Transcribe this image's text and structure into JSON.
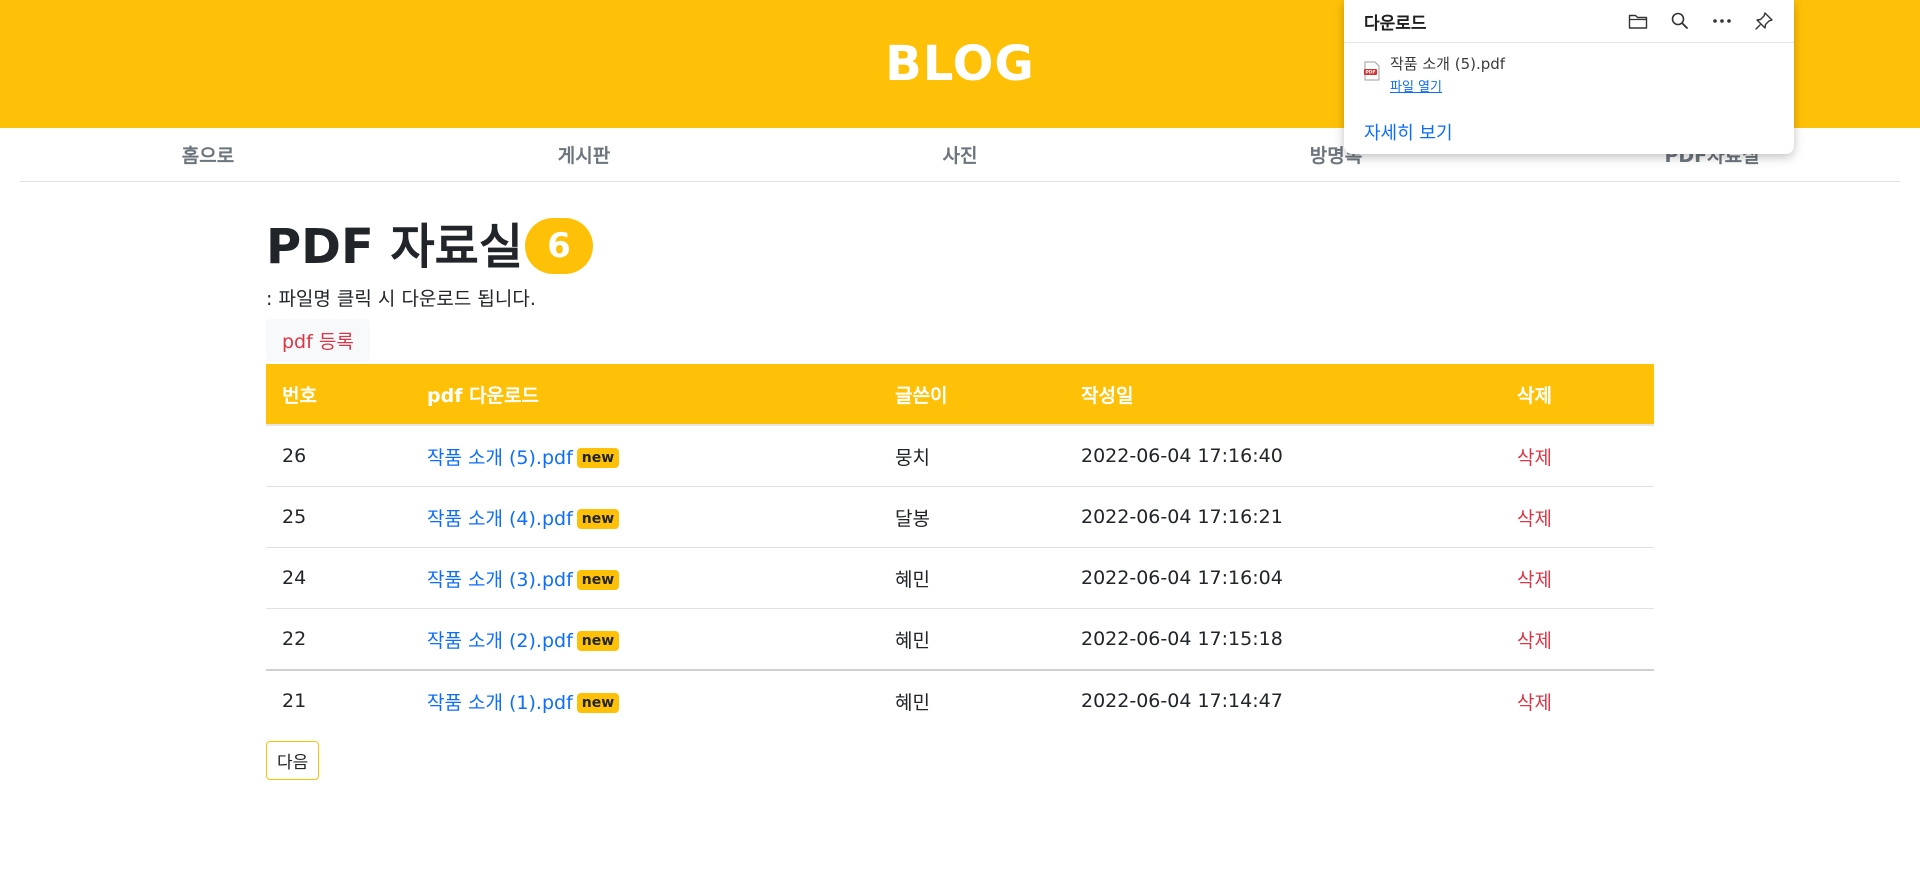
{
  "header": {
    "title": "BLOG"
  },
  "nav": {
    "items": [
      "홈으로",
      "게시판",
      "사진",
      "방명록",
      "PDF자료실"
    ]
  },
  "page": {
    "title": "PDF 자료실",
    "count": "6",
    "subtitle": ": 파일명 클릭 시 다운로드 됩니다.",
    "add_button": "pdf 등록",
    "next_button": "다음"
  },
  "table": {
    "headers": [
      "번호",
      "pdf 다운로드",
      "글쓴이",
      "작성일",
      "삭제"
    ],
    "rows": [
      {
        "no": "26",
        "file": "작품 소개 (5).pdf",
        "badge": "new",
        "author": "뭉치",
        "date": "2022-06-04 17:16:40",
        "delete": "삭제"
      },
      {
        "no": "25",
        "file": "작품 소개 (4).pdf",
        "badge": "new",
        "author": "달봉",
        "date": "2022-06-04 17:16:21",
        "delete": "삭제"
      },
      {
        "no": "24",
        "file": "작품 소개 (3).pdf",
        "badge": "new",
        "author": "혜민",
        "date": "2022-06-04 17:16:04",
        "delete": "삭제"
      },
      {
        "no": "22",
        "file": "작품 소개 (2).pdf",
        "badge": "new",
        "author": "혜민",
        "date": "2022-06-04 17:15:18",
        "delete": "삭제"
      },
      {
        "no": "21",
        "file": "작품 소개 (1).pdf",
        "badge": "new",
        "author": "혜민",
        "date": "2022-06-04 17:14:47",
        "delete": "삭제"
      }
    ]
  },
  "downloads": {
    "title": "다운로드",
    "icons": [
      "folder-icon",
      "search-icon",
      "more-icon",
      "pin-icon"
    ],
    "item_name": "작품 소개 (5).pdf",
    "open_label": "파일 열기",
    "more_label": "자세히 보기"
  },
  "colors": {
    "accent": "#ffc107",
    "link": "#0d6efd",
    "danger": "#dc3545"
  }
}
